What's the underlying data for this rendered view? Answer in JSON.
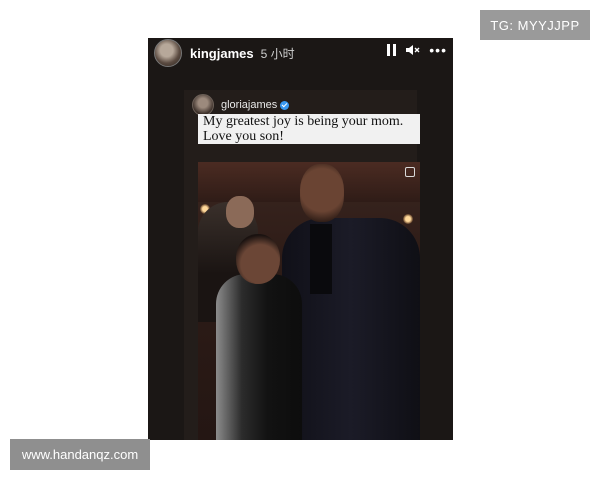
{
  "watermarks": {
    "top_right": "TG: MYYJJPP",
    "bottom_left": "www.handanqz.com"
  },
  "story": {
    "username": "kingjames",
    "time_ago": "5 小时",
    "controls": {
      "pause_icon": "pause-icon",
      "mute_icon": "mute-icon",
      "more_icon": "more-icon",
      "more_label": "•••"
    },
    "reshared_post": {
      "username": "gloriajames",
      "verified": true,
      "caption": "My greatest joy is being your mom. Love you son!",
      "photo": "photo of mother and son at an event"
    }
  },
  "colors": {
    "story_bg": "#1b1715",
    "caption_bg": "#f1f1f1",
    "verified": "#3897f0",
    "watermark_bg": "#9a9a9a"
  }
}
